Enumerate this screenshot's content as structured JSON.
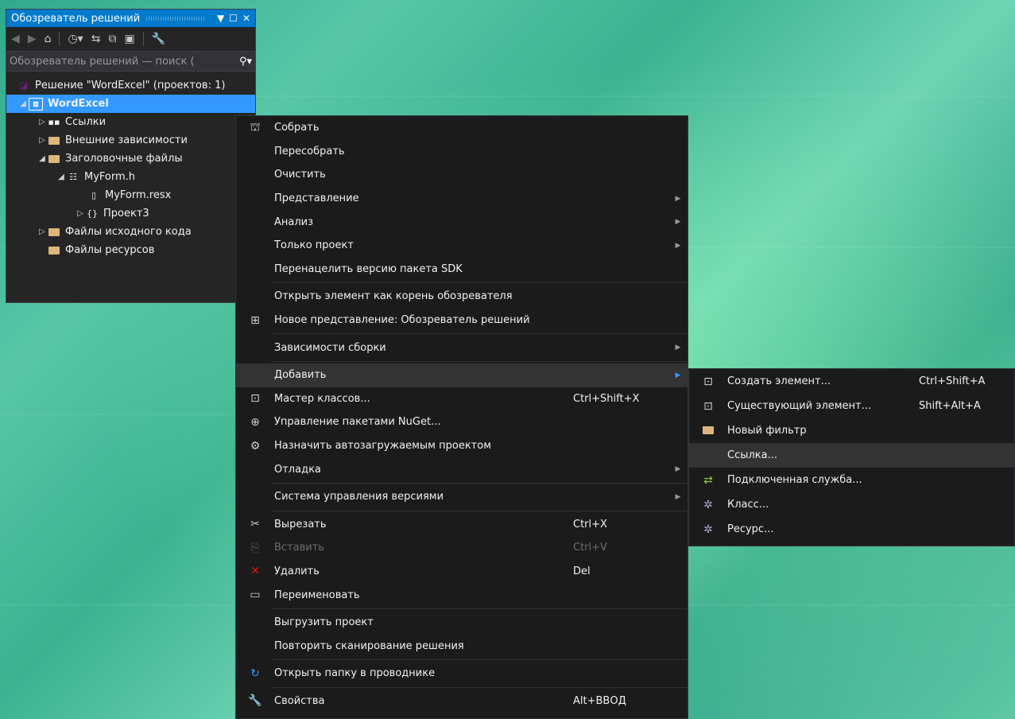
{
  "solution_explorer": {
    "title": "Обозреватель решений",
    "search_placeholder": "Обозреватель решений — поиск (",
    "tree": [
      {
        "label": "Решение \"WordExcel\" (проектов: 1)",
        "icon": "solution-icon",
        "arrow": ""
      },
      {
        "label": "WordExcel",
        "icon": "cpp-project-icon",
        "arrow": "◢",
        "selected": true
      },
      {
        "label": "Ссылки",
        "icon": "references-icon",
        "arrow": "▷"
      },
      {
        "label": "Внешние зависимости",
        "icon": "external-deps-icon",
        "arrow": "▷"
      },
      {
        "label": "Заголовочные файлы",
        "icon": "folder-icon",
        "arrow": "◢"
      },
      {
        "label": "MyForm.h",
        "icon": "form-icon",
        "arrow": "◢"
      },
      {
        "label": "MyForm.resx",
        "icon": "resx-file-icon",
        "arrow": ""
      },
      {
        "label": "Проект3",
        "icon": "namespace-icon",
        "arrow": "▷"
      },
      {
        "label": "Файлы исходного кода",
        "icon": "folder-icon",
        "arrow": "▷"
      },
      {
        "label": "Файлы ресурсов",
        "icon": "folder-icon",
        "arrow": ""
      }
    ]
  },
  "context_menu": {
    "items": [
      {
        "label": "Собрать",
        "icon": "build-icon"
      },
      {
        "label": "Пересобрать"
      },
      {
        "label": "Очистить"
      },
      {
        "label": "Представление",
        "submenu": true
      },
      {
        "label": "Анализ",
        "submenu": true
      },
      {
        "label": "Только проект",
        "submenu": true
      },
      {
        "label": "Перенацелить версию пакета SDK"
      },
      {
        "label": "Открыть элемент как корень обозревателя"
      },
      {
        "label": "Новое представление: Обозреватель решений",
        "icon": "new-view-icon"
      },
      {
        "label": "Зависимости сборки",
        "submenu": true
      },
      {
        "label": "Добавить",
        "submenu": true,
        "highlighted": true
      },
      {
        "label": "Мастер классов...",
        "shortcut": "Ctrl+Shift+X",
        "icon": "class-wizard-icon"
      },
      {
        "label": "Управление пакетами NuGet...",
        "icon": "nuget-icon"
      },
      {
        "label": "Назначить автозагружаемым проектом",
        "icon": "gear-icon"
      },
      {
        "label": "Отладка",
        "submenu": true
      },
      {
        "label": "Система управления версиями",
        "submenu": true
      },
      {
        "label": "Вырезать",
        "shortcut": "Ctrl+X",
        "icon": "cut-icon"
      },
      {
        "label": "Вставить",
        "shortcut": "Ctrl+V",
        "icon": "paste-icon",
        "disabled": true
      },
      {
        "label": "Удалить",
        "shortcut": "Del",
        "icon": "delete-icon"
      },
      {
        "label": "Переименовать",
        "icon": "rename-icon"
      },
      {
        "label": "Выгрузить проект"
      },
      {
        "label": "Повторить сканирование решения"
      },
      {
        "label": "Открыть папку в проводнике",
        "icon": "open-folder-icon"
      },
      {
        "label": "Свойства",
        "shortcut": "Alt+ВВОД",
        "icon": "wrench-icon"
      }
    ]
  },
  "add_submenu": {
    "items": [
      {
        "label": "Создать элемент...",
        "shortcut": "Ctrl+Shift+A",
        "icon": "new-item-icon"
      },
      {
        "label": "Существующий элемент...",
        "shortcut": "Shift+Alt+A",
        "icon": "existing-item-icon"
      },
      {
        "label": "Новый фильтр",
        "icon": "new-filter-icon"
      },
      {
        "label": "Ссылка...",
        "highlighted": true
      },
      {
        "label": "Подключенная служба...",
        "icon": "connected-service-icon"
      },
      {
        "label": "Класс...",
        "icon": "class-icon"
      },
      {
        "label": "Ресурс...",
        "icon": "resource-icon"
      }
    ]
  },
  "colors": {
    "accent": "#007acc",
    "selection": "#3399ff",
    "menu_bg": "#1b1b1c",
    "panel_bg": "#252526"
  }
}
